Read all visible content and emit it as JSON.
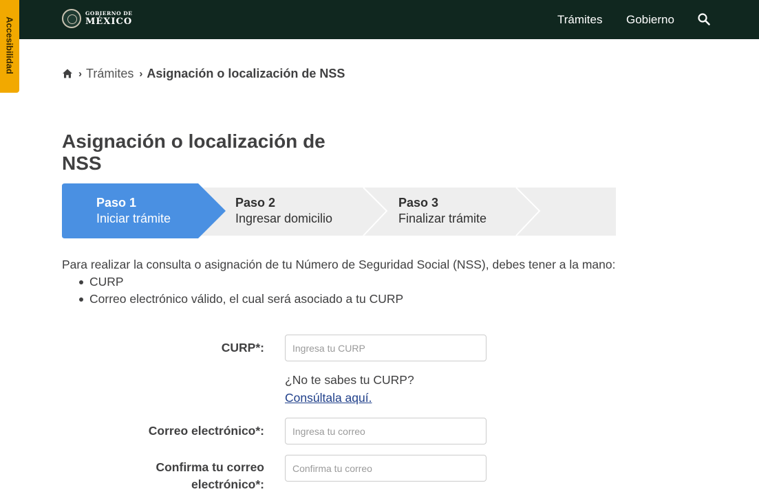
{
  "header": {
    "logo_small": "GOBIERNO DE",
    "logo_main": "MÉXICO",
    "nav": [
      "Trámites",
      "Gobierno"
    ]
  },
  "accessibility": {
    "label": "Accesibilidad",
    "color": "#f2a900"
  },
  "breadcrumb": {
    "items": [
      "Trámites",
      "Asignación o localización de NSS"
    ]
  },
  "page": {
    "title": "Asignación o localización de NSS"
  },
  "stepper": {
    "active_color": "#4a90e2",
    "inactive_color": "#eeeeee",
    "steps": [
      {
        "num": "Paso 1",
        "label": "Iniciar trámite",
        "active": true
      },
      {
        "num": "Paso 2",
        "label": "Ingresar domicilio",
        "active": false
      },
      {
        "num": "Paso 3",
        "label": "Finalizar trámite",
        "active": false
      }
    ]
  },
  "intro": {
    "text": "Para realizar la consulta o asignación de tu Número de Seguridad Social (NSS), debes tener a la mano:",
    "requirements": [
      "CURP",
      "Correo electrónico válido, el cual será asociado a tu CURP"
    ]
  },
  "form": {
    "curp_label": "CURP*:",
    "curp_placeholder": "Ingresa tu CURP",
    "curp_help": "¿No te sabes tu CURP?",
    "curp_link": "Consúltala aquí.",
    "email_label": "Correo electrónico*:",
    "email_placeholder": "Ingresa tu correo",
    "confirm_label_line1": "Confirma tu correo",
    "confirm_label_line2": "electrónico*:",
    "confirm_placeholder": "Confirma tu correo"
  },
  "icons": [
    "search-icon",
    "home-icon",
    "chevron-right-icon",
    "seal-icon"
  ],
  "colors": {
    "header_bg": "#10271f",
    "link": "#1f3f8a"
  }
}
